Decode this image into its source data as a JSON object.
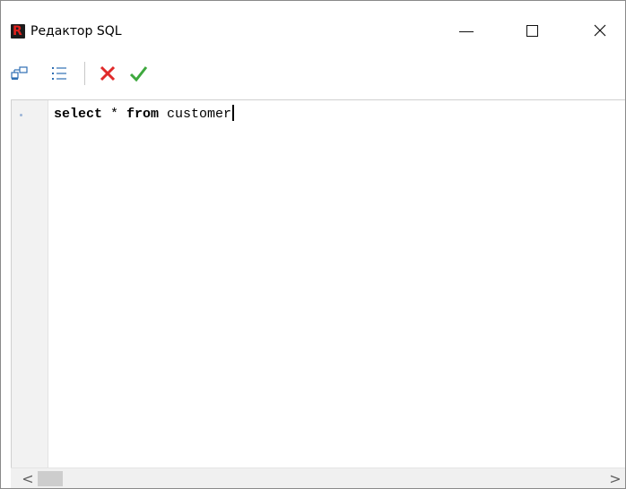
{
  "window": {
    "title": "Редактор SQL",
    "app_icon_letter": "R",
    "controls": {
      "minimize": "minimize",
      "maximize": "maximize",
      "close": "close"
    }
  },
  "toolbar": {
    "buttons": [
      {
        "name": "query-builder",
        "icon": "query-builder-icon"
      },
      {
        "name": "list",
        "icon": "list-icon"
      },
      {
        "name": "cancel",
        "icon": "red-x-icon",
        "color": "#e02a2a"
      },
      {
        "name": "ok",
        "icon": "green-check-icon",
        "color": "#3ea83e"
      }
    ]
  },
  "editor": {
    "lines": [
      {
        "keyword1": "select",
        "operator": " * ",
        "keyword2": "from",
        "rest": " customer"
      }
    ],
    "current_line_marker_color": "#9bb4d6"
  },
  "scrollbar": {
    "left_arrow": "<",
    "right_arrow": ">"
  }
}
